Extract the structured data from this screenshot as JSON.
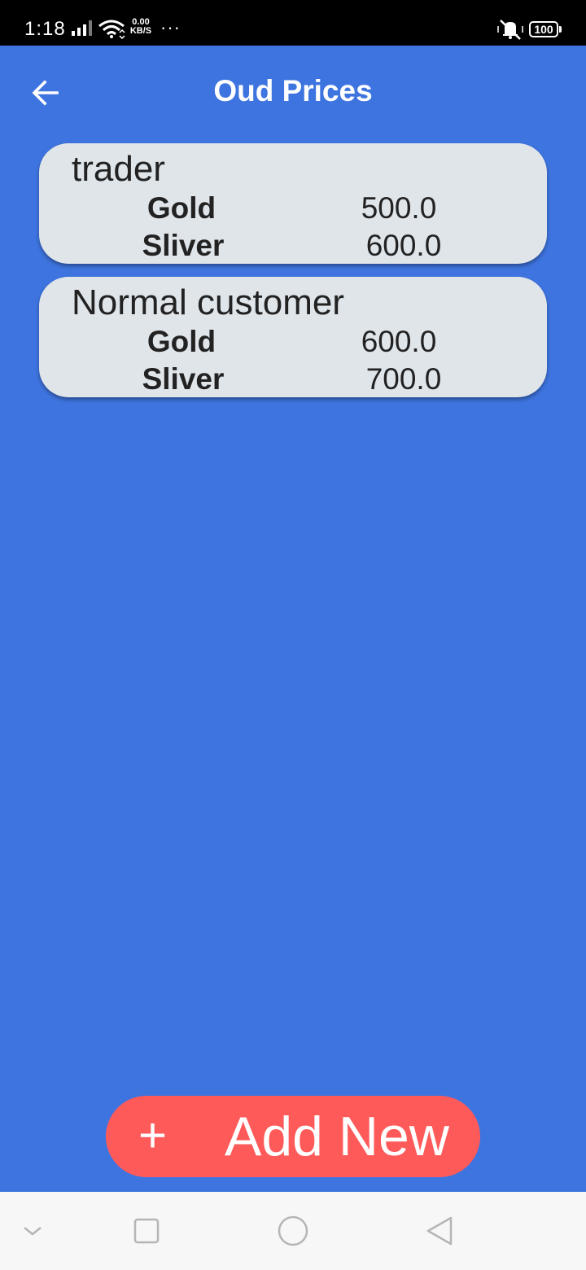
{
  "status_bar": {
    "time": "1:18",
    "speed_value": "0.00",
    "speed_unit": "KB/S",
    "more": "···",
    "battery": "100",
    "icons": [
      "signal-icon",
      "wifi-icon",
      "more-icon",
      "vibrate-mute-icon",
      "battery-icon"
    ]
  },
  "app_bar": {
    "title": "Oud Prices",
    "back_icon": "arrow-left-icon"
  },
  "cards": [
    {
      "title": "trader",
      "rows": [
        {
          "label": "Gold",
          "value": "500.0"
        },
        {
          "label": "Sliver",
          "value": "600.0"
        }
      ]
    },
    {
      "title": "Normal customer",
      "rows": [
        {
          "label": "Gold",
          "value": "600.0"
        },
        {
          "label": "Sliver",
          "value": "700.0"
        }
      ]
    }
  ],
  "add_button": {
    "icon": "+",
    "label": "Add New"
  },
  "nav_bar": {
    "icons": [
      "chevron-down-icon",
      "square-icon",
      "circle-icon",
      "triangle-back-icon"
    ]
  },
  "colors": {
    "background": "#3e74df",
    "card": "#e0e5ea",
    "add_button": "#ff5a5a",
    "nav_bar": "#f7f7f7",
    "status_bar": "#000000"
  }
}
